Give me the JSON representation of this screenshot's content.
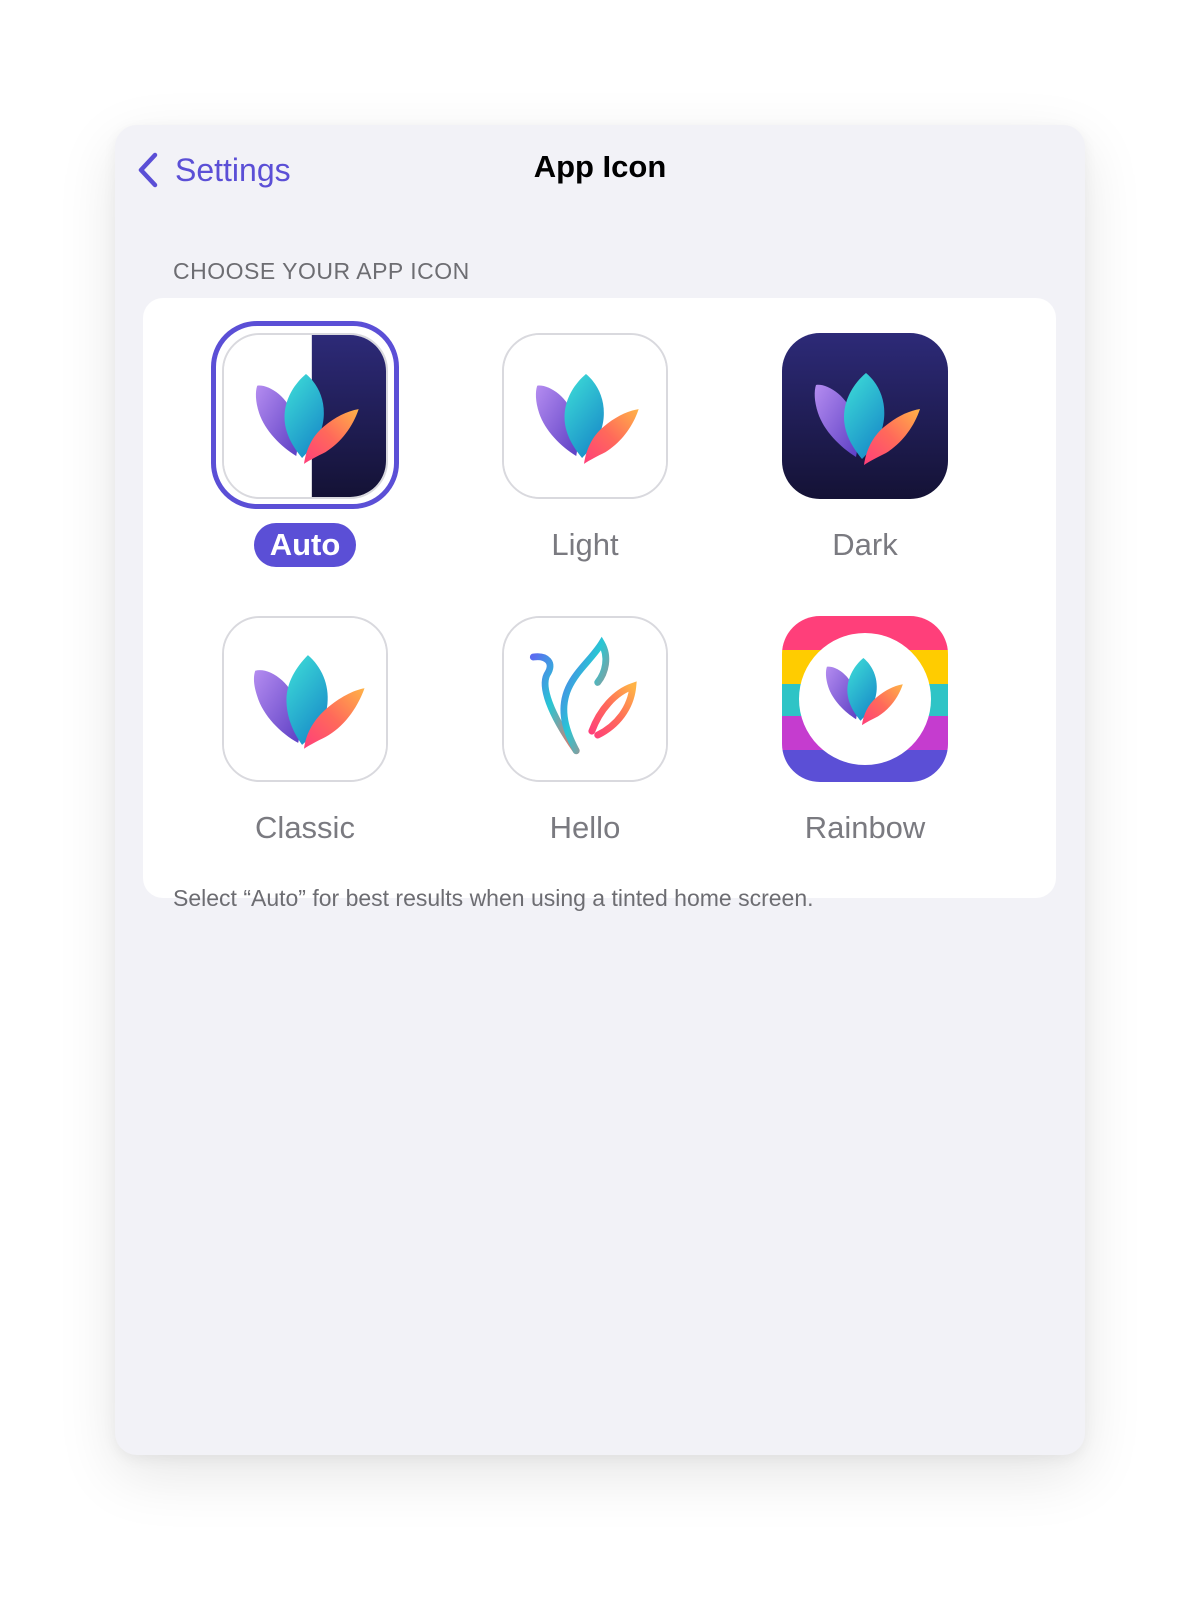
{
  "nav": {
    "back_label": "Settings",
    "title": "App Icon"
  },
  "section": {
    "header": "CHOOSE YOUR APP ICON",
    "footer": "Select “Auto” for best results when using a tinted home screen."
  },
  "icons": [
    {
      "label": "Auto",
      "selected": true,
      "icon": "lotus-auto-icon"
    },
    {
      "label": "Light",
      "selected": false,
      "icon": "lotus-light-icon"
    },
    {
      "label": "Dark",
      "selected": false,
      "icon": "lotus-dark-icon"
    },
    {
      "label": "Classic",
      "selected": false,
      "icon": "lotus-classic-icon"
    },
    {
      "label": "Hello",
      "selected": false,
      "icon": "lotus-hello-icon"
    },
    {
      "label": "Rainbow",
      "selected": false,
      "icon": "lotus-rainbow-icon"
    }
  ],
  "colors": {
    "accent": "#5b4fd6",
    "background": "#f2f2f7",
    "card": "#ffffff",
    "dark_icon_bg": "#1f1b4d"
  }
}
